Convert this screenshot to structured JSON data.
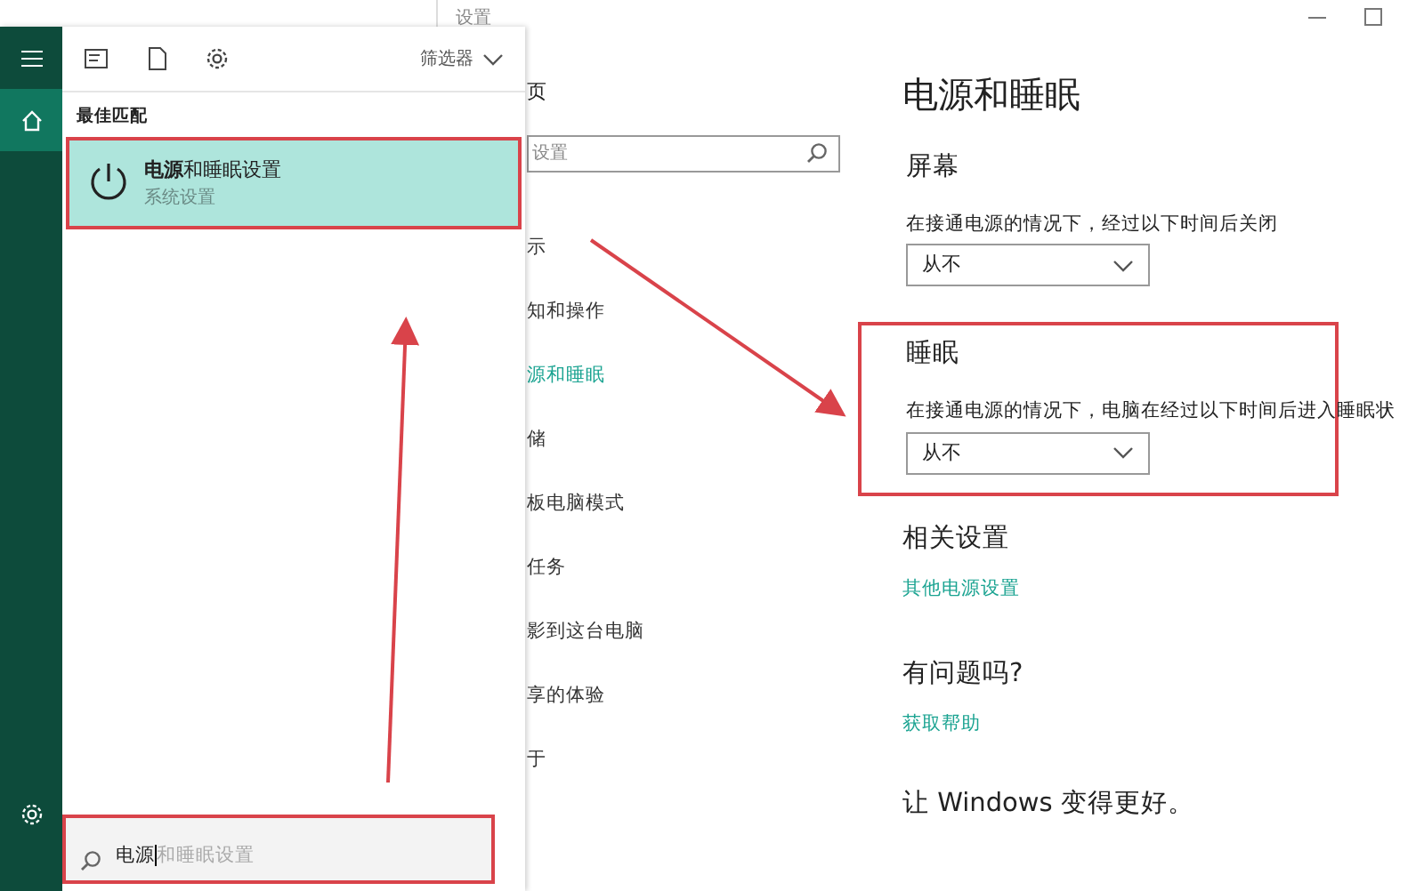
{
  "settings_window": {
    "title": "设置",
    "nav": {
      "heading": "页",
      "search_placeholder": "设置",
      "items": [
        {
          "label": "示",
          "selected": false
        },
        {
          "label": "知和操作",
          "selected": false
        },
        {
          "label": "源和睡眠",
          "selected": true
        },
        {
          "label": "储",
          "selected": false
        },
        {
          "label": "板电脑模式",
          "selected": false
        },
        {
          "label": "任务",
          "selected": false
        },
        {
          "label": "影到这台电脑",
          "selected": false
        },
        {
          "label": "享的体验",
          "selected": false
        },
        {
          "label": "于",
          "selected": false
        }
      ]
    },
    "page": {
      "title": "电源和睡眠",
      "sections": [
        {
          "heading": "屏幕",
          "description": "在接通电源的情况下，经过以下时间后关闭",
          "dropdown": "从不",
          "highlighted": false
        },
        {
          "heading": "睡眠",
          "description": "在接通电源的情况下，电脑在经过以下时间后进入睡眠状",
          "dropdown": "从不",
          "highlighted": true
        }
      ],
      "related": {
        "heading": "相关设置",
        "link": "其他电源设置"
      },
      "help": {
        "heading": "有问题吗?",
        "link": "获取帮助"
      },
      "feedback": {
        "heading": "让 Windows 变得更好。"
      }
    }
  },
  "start_menu": {
    "rail": [
      {
        "kind": "menu",
        "selected": false
      },
      {
        "kind": "home",
        "selected": true
      },
      {
        "kind": "settings",
        "selected": false
      }
    ],
    "filter": "筛选器",
    "best_match_label": "最佳匹配",
    "result": {
      "title": "**电源**和睡眠设置",
      "subtitle": "系统设置",
      "selected": true,
      "highlighted": true
    },
    "search": {
      "value": "电源",
      "suggestion": "和睡眠设置",
      "highlighted": true
    }
  }
}
